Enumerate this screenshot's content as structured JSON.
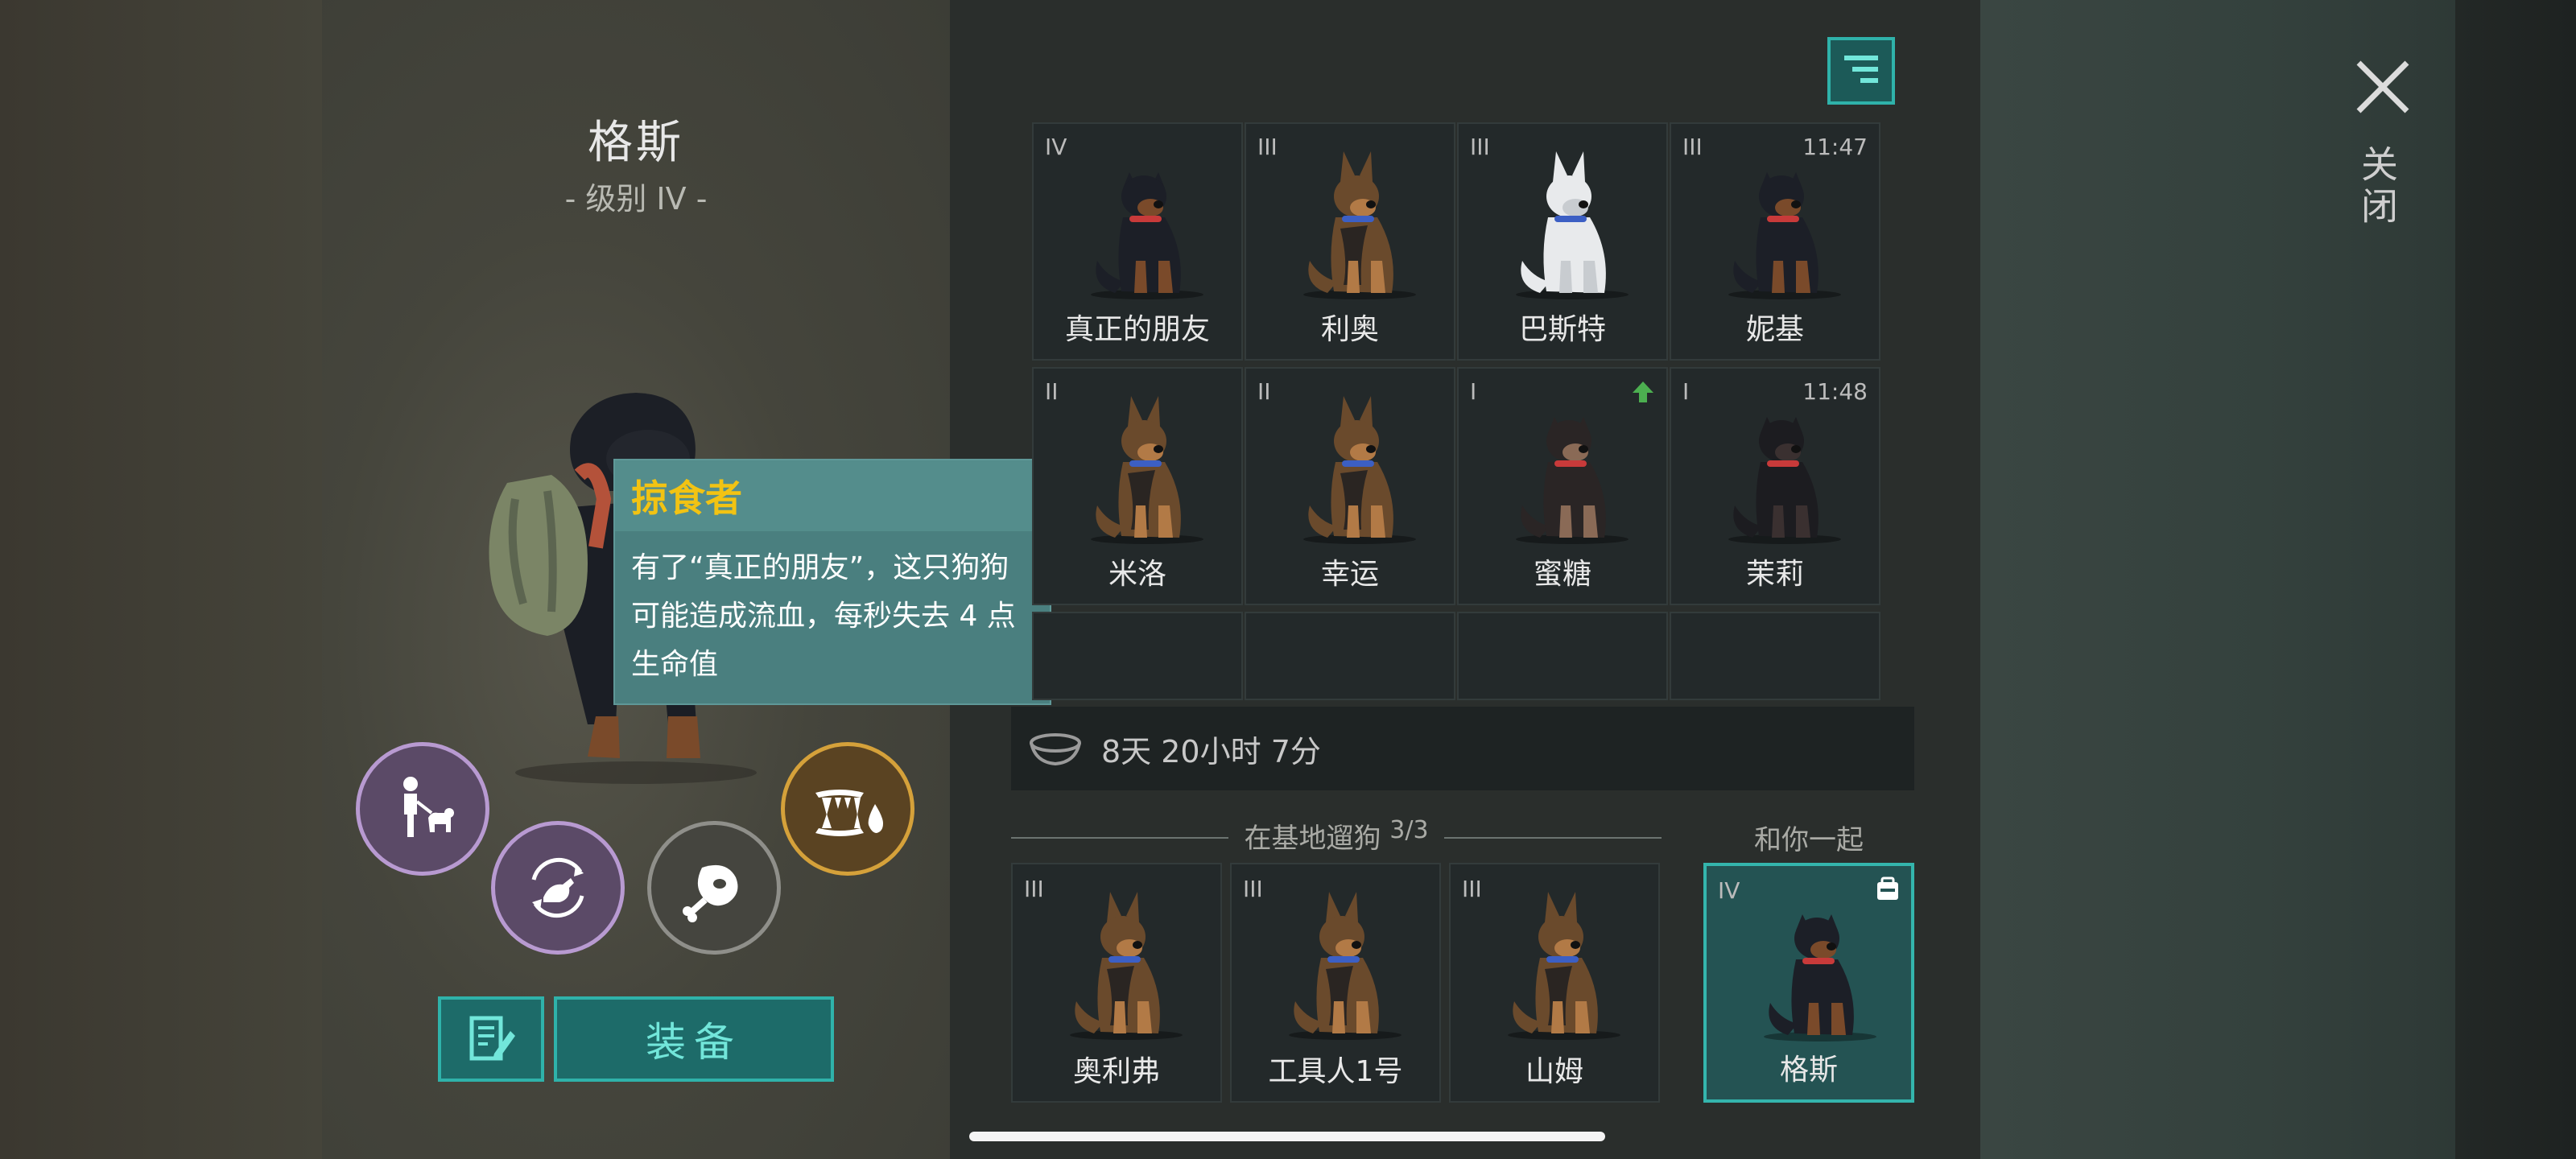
{
  "dog": {
    "name": "格斯",
    "level": "- 级别 IV -"
  },
  "tooltip": {
    "title": "掠食者",
    "body": "有了“真正的朋友”，这只狗狗可能造成流血，每秒失去 4 点生命值"
  },
  "abilities": [
    "walk-with-owner-icon",
    "dog-swap-icon",
    "meat-icon",
    "fang-blood-icon"
  ],
  "buttons": {
    "equip": "装备"
  },
  "grid": [
    {
      "level": "IV",
      "name": "真正的朋友",
      "time": "",
      "breed": "rottweiler"
    },
    {
      "level": "III",
      "name": "利奥",
      "time": "",
      "breed": "shepherd"
    },
    {
      "level": "III",
      "name": "巴斯特",
      "time": "",
      "breed": "white"
    },
    {
      "level": "III",
      "name": "妮基",
      "time": "11:47",
      "breed": "rottweiler"
    },
    {
      "level": "II",
      "name": "米洛",
      "time": "",
      "breed": "shepherd"
    },
    {
      "level": "II",
      "name": "幸运",
      "time": "",
      "breed": "shepherd"
    },
    {
      "level": "I",
      "name": "蜜糖",
      "time": "",
      "breed": "puppy",
      "upgrade": true
    },
    {
      "level": "I",
      "name": "茉莉",
      "time": "11:48",
      "breed": "puppy-dark"
    }
  ],
  "timer": {
    "text": "8天 20小时 7分"
  },
  "walking": {
    "label": "在基地遛狗",
    "count": "3/3",
    "dogs": [
      {
        "level": "III",
        "name": "奥利弗"
      },
      {
        "level": "III",
        "name": "工具人1号"
      },
      {
        "level": "III",
        "name": "山姆"
      }
    ]
  },
  "with_you": {
    "label": "和你一起",
    "level": "IV",
    "name": "格斯"
  },
  "close": {
    "label": "关闭"
  },
  "colors": {
    "accent": "#2fb2aa",
    "tooltip_title": "#f2c313",
    "purple_ring": "#b89ad1",
    "gold_ring": "#d5a13a"
  }
}
